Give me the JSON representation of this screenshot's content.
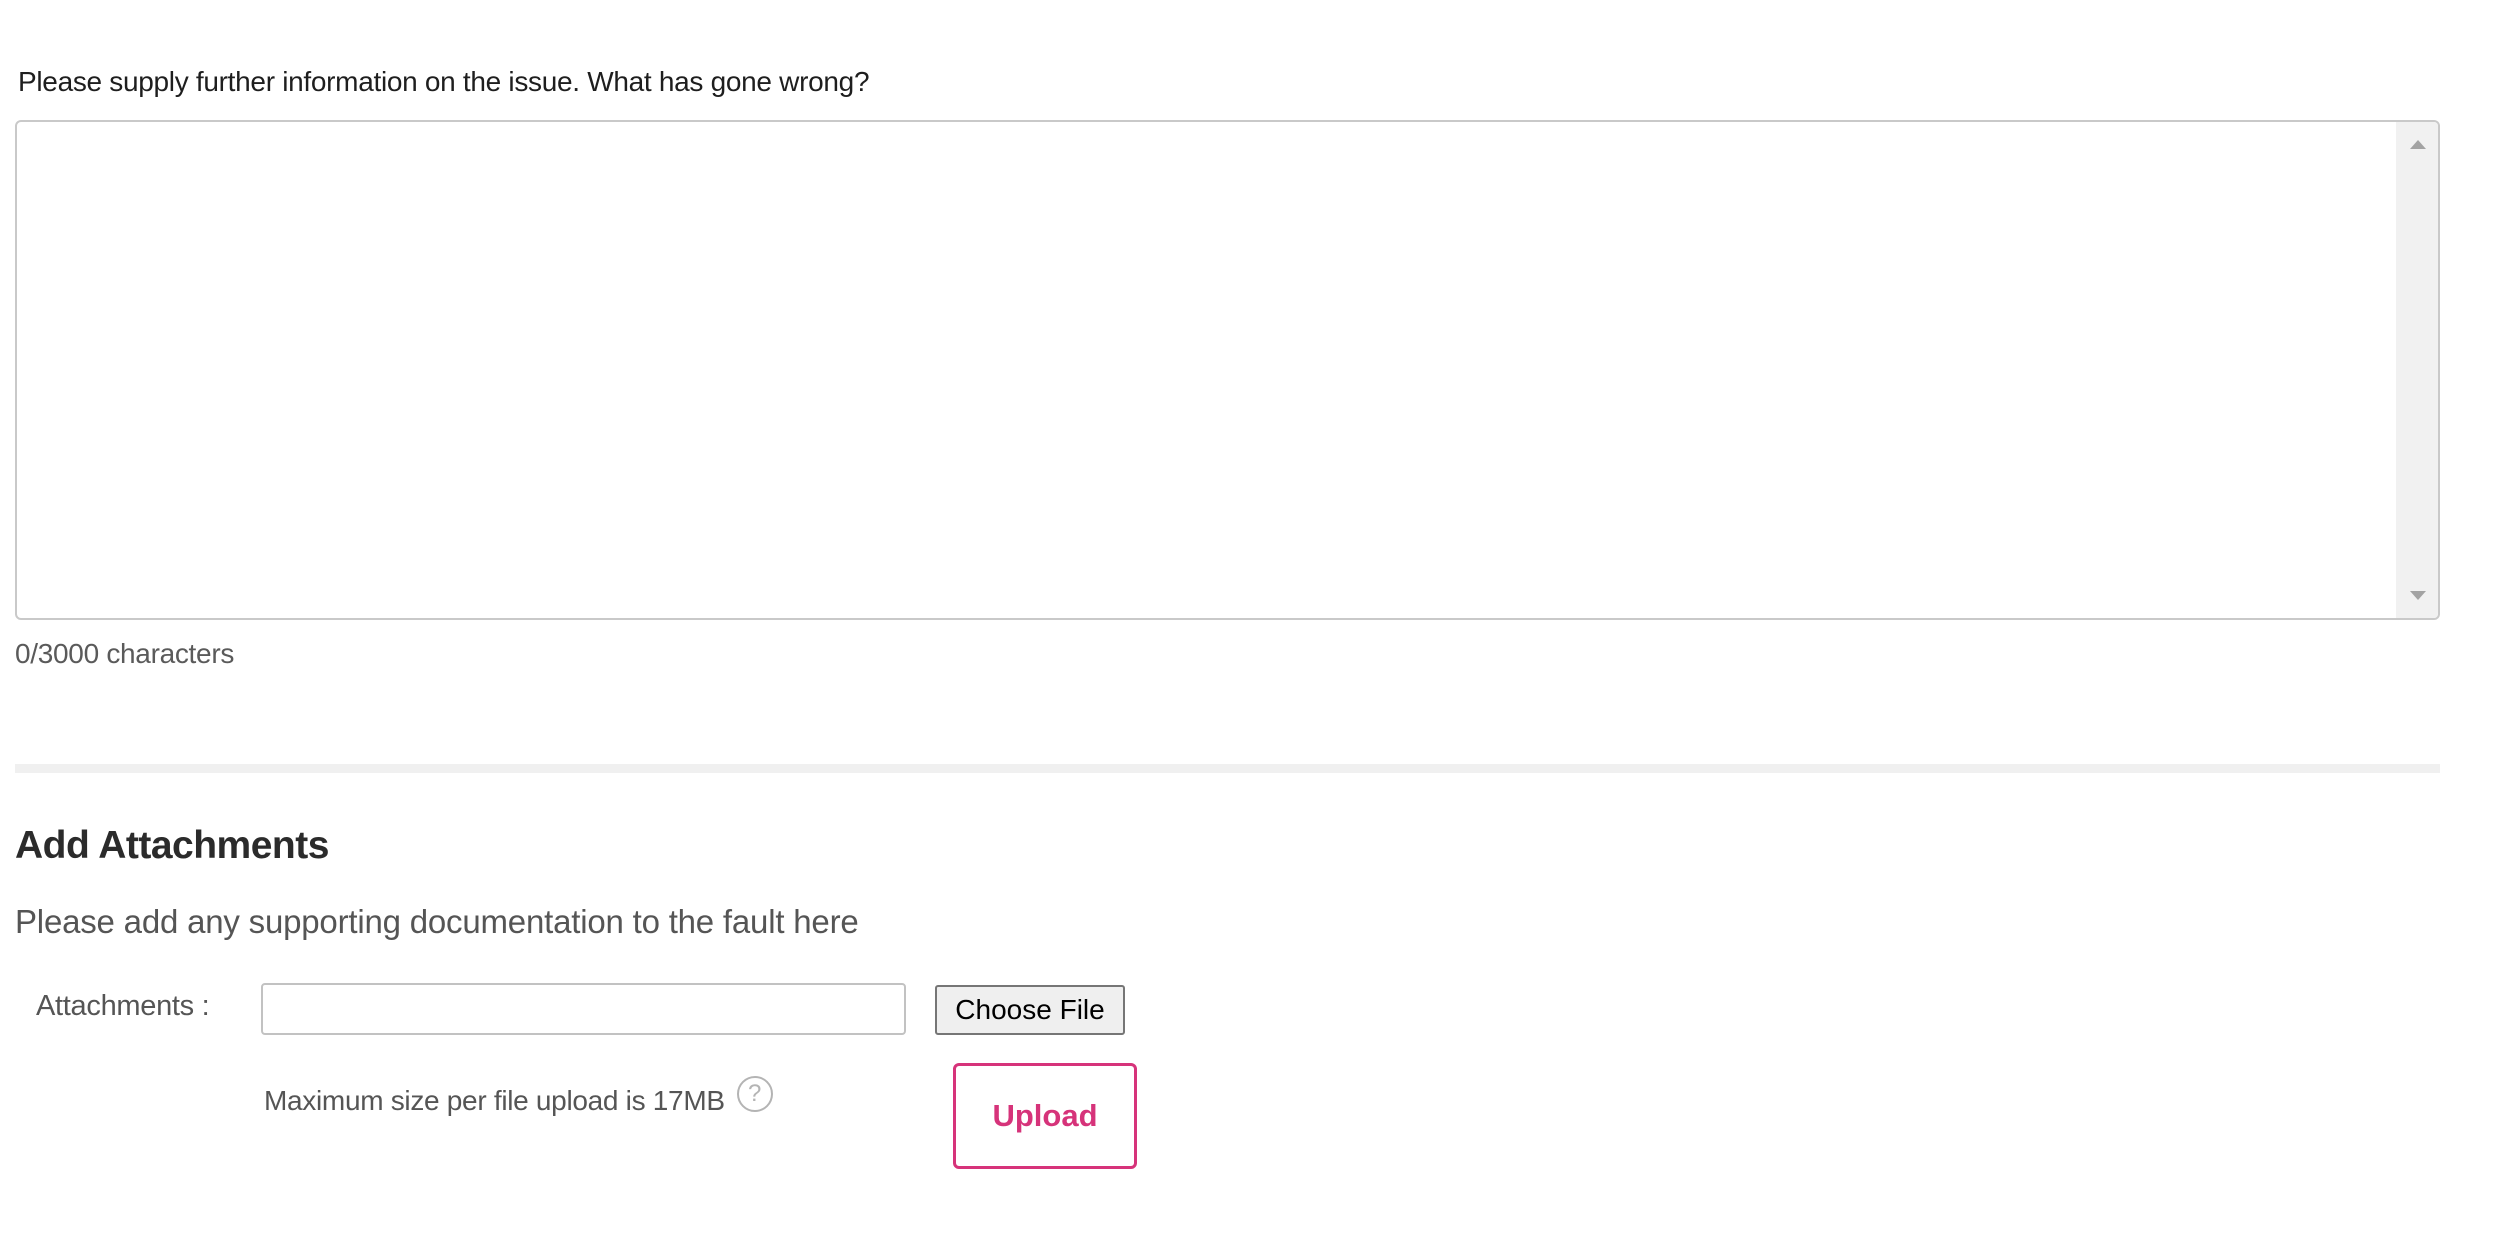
{
  "issue": {
    "question": "Please supply further information on the issue. What has gone wrong?",
    "value": "",
    "char_count": "0/3000 characters"
  },
  "attachments": {
    "title": "Add Attachments",
    "description": "Please add any supporting documentation to the fault here",
    "label": "Attachments :",
    "file_value": "",
    "choose_button": "Choose File",
    "max_size": "Maximum size per file upload is 17MB",
    "help_icon": "question-mark-circle-icon",
    "help_glyph": "?",
    "upload_button": "Upload"
  },
  "colors": {
    "accent": "#d6337a",
    "divider": "#f0f0f0",
    "border": "#c9c9c9"
  }
}
